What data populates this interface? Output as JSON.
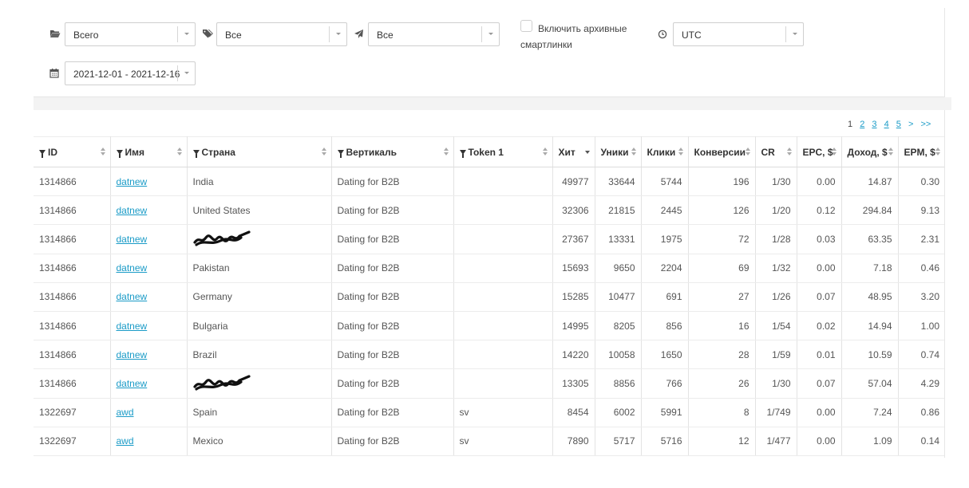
{
  "filters": {
    "scope": "Всего",
    "tags": "Все",
    "traffic": "Все",
    "archive_label": "Включить архивные смартлинки",
    "timezone": "UTC",
    "date_range": "2021-12-01 - 2021-12-16"
  },
  "pagination": {
    "current": "1",
    "pages": [
      "2",
      "3",
      "4",
      "5"
    ],
    "next": ">",
    "last": ">>"
  },
  "columns": [
    {
      "label": "ID",
      "filter": true
    },
    {
      "label": "Имя",
      "filter": true
    },
    {
      "label": "Страна",
      "filter": true
    },
    {
      "label": "Вертикаль",
      "filter": true
    },
    {
      "label": "Token 1",
      "filter": true
    },
    {
      "label": "Хит",
      "filter": false
    },
    {
      "label": "Уники",
      "filter": false
    },
    {
      "label": "Клики",
      "filter": false
    },
    {
      "label": "Конверсии",
      "filter": false
    },
    {
      "label": "CR",
      "filter": false
    },
    {
      "label": "EPC, $",
      "filter": false
    },
    {
      "label": "Доход, $",
      "filter": false
    },
    {
      "label": "EPM, $",
      "filter": false
    }
  ],
  "rows": [
    {
      "id": "1314866",
      "name": "datnew",
      "country": "India",
      "vertical": "Dating for B2B",
      "token": "",
      "hits": "49977",
      "uniques": "33644",
      "clicks": "5744",
      "conv": "196",
      "cr": "1/30",
      "epc": "0.00",
      "revenue": "14.87",
      "epm": "0.30"
    },
    {
      "id": "1314866",
      "name": "datnew",
      "country": "United States",
      "vertical": "Dating for B2B",
      "token": "",
      "hits": "32306",
      "uniques": "21815",
      "clicks": "2445",
      "conv": "126",
      "cr": "1/20",
      "epc": "0.12",
      "revenue": "294.84",
      "epm": "9.13"
    },
    {
      "id": "1314866",
      "name": "datnew",
      "country": "",
      "redacted": true,
      "vertical": "Dating for B2B",
      "token": "",
      "hits": "27367",
      "uniques": "13331",
      "clicks": "1975",
      "conv": "72",
      "cr": "1/28",
      "epc": "0.03",
      "revenue": "63.35",
      "epm": "2.31"
    },
    {
      "id": "1314866",
      "name": "datnew",
      "country": "Pakistan",
      "vertical": "Dating for B2B",
      "token": "",
      "hits": "15693",
      "uniques": "9650",
      "clicks": "2204",
      "conv": "69",
      "cr": "1/32",
      "epc": "0.00",
      "revenue": "7.18",
      "epm": "0.46"
    },
    {
      "id": "1314866",
      "name": "datnew",
      "country": "Germany",
      "vertical": "Dating for B2B",
      "token": "",
      "hits": "15285",
      "uniques": "10477",
      "clicks": "691",
      "conv": "27",
      "cr": "1/26",
      "epc": "0.07",
      "revenue": "48.95",
      "epm": "3.20"
    },
    {
      "id": "1314866",
      "name": "datnew",
      "country": "Bulgaria",
      "vertical": "Dating for B2B",
      "token": "",
      "hits": "14995",
      "uniques": "8205",
      "clicks": "856",
      "conv": "16",
      "cr": "1/54",
      "epc": "0.02",
      "revenue": "14.94",
      "epm": "1.00"
    },
    {
      "id": "1314866",
      "name": "datnew",
      "country": "Brazil",
      "vertical": "Dating for B2B",
      "token": "",
      "hits": "14220",
      "uniques": "10058",
      "clicks": "1650",
      "conv": "28",
      "cr": "1/59",
      "epc": "0.01",
      "revenue": "10.59",
      "epm": "0.74"
    },
    {
      "id": "1314866",
      "name": "datnew",
      "country": "",
      "redacted": true,
      "vertical": "Dating for B2B",
      "token": "",
      "hits": "13305",
      "uniques": "8856",
      "clicks": "766",
      "conv": "26",
      "cr": "1/30",
      "epc": "0.07",
      "revenue": "57.04",
      "epm": "4.29"
    },
    {
      "id": "1322697",
      "name": "awd",
      "country": "Spain",
      "vertical": "Dating for B2B",
      "token": "sv",
      "hits": "8454",
      "uniques": "6002",
      "clicks": "5991",
      "conv": "8",
      "cr": "1/749",
      "epc": "0.00",
      "revenue": "7.24",
      "epm": "0.86"
    },
    {
      "id": "1322697",
      "name": "awd",
      "country": "Mexico",
      "vertical": "Dating for B2B",
      "token": "sv",
      "hits": "7890",
      "uniques": "5717",
      "clicks": "5716",
      "conv": "12",
      "cr": "1/477",
      "epc": "0.00",
      "revenue": "1.09",
      "epm": "0.14"
    }
  ]
}
